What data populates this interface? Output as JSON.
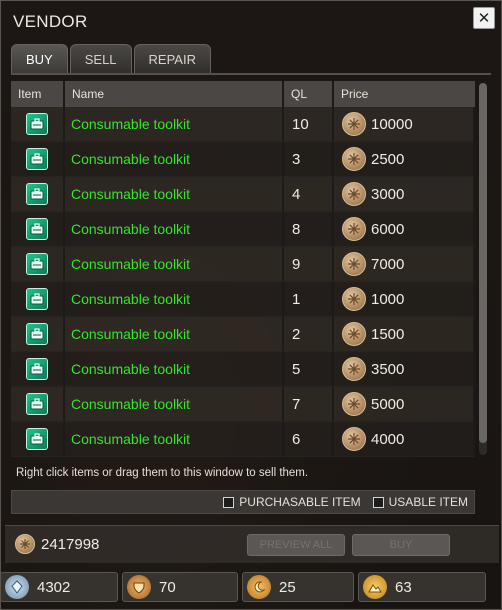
{
  "window": {
    "title": "VENDOR",
    "close_label": "✕"
  },
  "tabs": [
    {
      "label": "BUY",
      "active": true
    },
    {
      "label": "SELL",
      "active": false
    },
    {
      "label": "REPAIR",
      "active": false
    }
  ],
  "table": {
    "headers": {
      "item": "Item",
      "name": "Name",
      "ql": "QL",
      "price": "Price"
    },
    "rows": [
      {
        "icon": "toolkit-icon",
        "name": "Consumable toolkit",
        "ql": "10",
        "price": "10000"
      },
      {
        "icon": "toolkit-icon",
        "name": "Consumable toolkit",
        "ql": "3",
        "price": "2500"
      },
      {
        "icon": "toolkit-icon",
        "name": "Consumable toolkit",
        "ql": "4",
        "price": "3000"
      },
      {
        "icon": "toolkit-icon",
        "name": "Consumable toolkit",
        "ql": "8",
        "price": "6000"
      },
      {
        "icon": "toolkit-icon",
        "name": "Consumable toolkit",
        "ql": "9",
        "price": "7000"
      },
      {
        "icon": "toolkit-icon",
        "name": "Consumable toolkit",
        "ql": "1",
        "price": "1000"
      },
      {
        "icon": "toolkit-icon",
        "name": "Consumable toolkit",
        "ql": "2",
        "price": "1500"
      },
      {
        "icon": "toolkit-icon",
        "name": "Consumable toolkit",
        "ql": "5",
        "price": "3500"
      },
      {
        "icon": "toolkit-icon",
        "name": "Consumable toolkit",
        "ql": "7",
        "price": "5000"
      },
      {
        "icon": "toolkit-icon",
        "name": "Consumable toolkit",
        "ql": "6",
        "price": "4000"
      }
    ]
  },
  "hint": "Right click items or drag them to this window to sell them.",
  "filters": {
    "purchasable_label": "PURCHASABLE ITEM",
    "usable_label": "USABLE ITEM"
  },
  "footer": {
    "money": "2417998",
    "preview_label": "PREVIEW ALL",
    "buy_label": "BUY"
  },
  "currencies": [
    {
      "icon": "crystal-icon",
      "value": "4302"
    },
    {
      "icon": "shield-icon",
      "value": "70"
    },
    {
      "icon": "moon-icon",
      "value": "25"
    },
    {
      "icon": "mountain-icon",
      "value": "63"
    }
  ],
  "colors": {
    "item_name": "#35e42b",
    "coin": "#c4a070"
  }
}
